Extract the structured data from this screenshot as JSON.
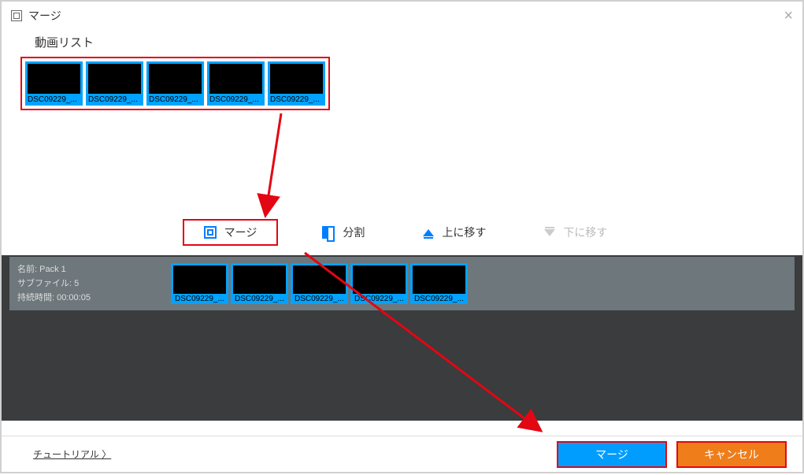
{
  "titlebar": {
    "title": "マージ"
  },
  "video_list": {
    "heading": "動画リスト",
    "items": [
      {
        "label": "DSC09229_..."
      },
      {
        "label": "DSC09229_..."
      },
      {
        "label": "DSC09229_..."
      },
      {
        "label": "DSC09229_..."
      },
      {
        "label": "DSC09229_..."
      }
    ]
  },
  "toolbar": {
    "merge": "マージ",
    "split": "分割",
    "move_up": "上に移す",
    "move_down": "下に移す"
  },
  "pack": {
    "name_label": "名前:",
    "name_value": "Pack 1",
    "sub_label": "サブファイル:",
    "sub_value": "5",
    "dur_label": "持続時間:",
    "dur_value": "00:00:05",
    "items": [
      {
        "label": "DSC09229_..."
      },
      {
        "label": "DSC09229_..."
      },
      {
        "label": "DSC09229_..."
      },
      {
        "label": "DSC09229_..."
      },
      {
        "label": "DSC09229_..."
      }
    ]
  },
  "footer": {
    "tutorial": "チュートリアル 〉",
    "merge_btn": "マージ",
    "cancel_btn": "キャンセル"
  }
}
